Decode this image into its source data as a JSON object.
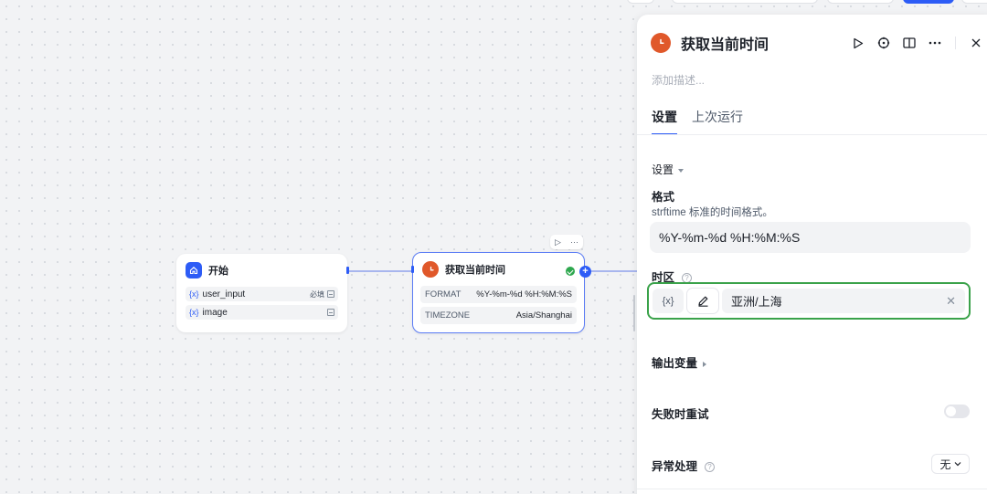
{
  "canvas": {
    "start_node": {
      "title": "开始",
      "variables": [
        {
          "prefix": "{x}",
          "name": "user_input",
          "badge": "必填"
        },
        {
          "prefix": "{x}",
          "name": "image",
          "badge": ""
        }
      ]
    },
    "time_node": {
      "title": "获取当前时间",
      "params": [
        {
          "key": "FORMAT",
          "value": "%Y-%m-%d %H:%M:%S"
        },
        {
          "key": "TIMEZONE",
          "value": "Asia/Shanghai"
        }
      ],
      "tools": {
        "run": "▷",
        "more": "···"
      },
      "add_label": "+"
    }
  },
  "panel": {
    "title": "获取当前时间",
    "description_placeholder": "添加描述...",
    "tabs": [
      {
        "label": "设置",
        "active": true
      },
      {
        "label": "上次运行",
        "active": false
      }
    ],
    "settings_section": "设置",
    "format": {
      "label": "格式",
      "hint": "strftime 标准的时间格式。",
      "value": "%Y-%m-%d %H:%M:%S"
    },
    "timezone": {
      "label": "时区",
      "var_btn": "{x}",
      "value": "亚洲/上海",
      "clear": "✕"
    },
    "output_vars": "输出变量",
    "retry_on_fail": "失败时重试",
    "error_handling": {
      "label": "异常处理",
      "value": "无"
    }
  },
  "colors": {
    "accent": "#2d5cf6",
    "node_orange": "#e0582a",
    "focus_green": "#3aa24a"
  }
}
